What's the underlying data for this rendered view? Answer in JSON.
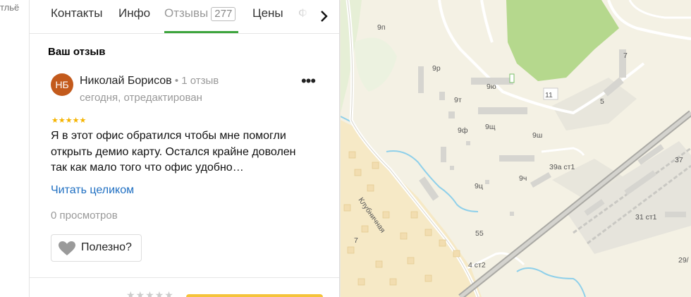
{
  "gutter": {
    "text": "тльё"
  },
  "tabs": [
    {
      "label": "Контакты"
    },
    {
      "label": "Инфо"
    },
    {
      "label": "Отзывы",
      "count": "277"
    },
    {
      "label": "Цены"
    },
    {
      "label": "Ф"
    }
  ],
  "section_title": "Ваш отзыв",
  "review": {
    "avatar_initials": "НБ",
    "author": "Николай Борисов",
    "separator": " • ",
    "reviews_count": "1 отзыв",
    "date": "сегодня, отредактирован",
    "more_glyph": "•••",
    "stars": "★★★★★",
    "rating": 5,
    "text_lines": [
      "Я в этот офис обратился чтобы мне помогли",
      "открыть демио карту. Остался крайне доволен",
      "так как мало того что офис удобно…"
    ],
    "read_more": "Читать целиком",
    "views": "0 просмотров",
    "useful": "Полезно?"
  },
  "bottom": {
    "stars": "★★★★★"
  },
  "colors": {
    "accent_green": "#3ea53e",
    "avatar": "#c35a1c",
    "link": "#1f6fc2",
    "star": "#f5b400",
    "cta": "#f5c33b"
  },
  "map": {
    "labels": [
      "9п",
      "9р",
      "9ю",
      "9т",
      "9ф",
      "9щ",
      "9ш",
      "9ч",
      "9ц",
      "39а ст1",
      "37",
      "31 ст1",
      "29/",
      "55",
      "4 ст2",
      "7",
      "Клубничная",
      "11",
      "5",
      "7"
    ]
  }
}
